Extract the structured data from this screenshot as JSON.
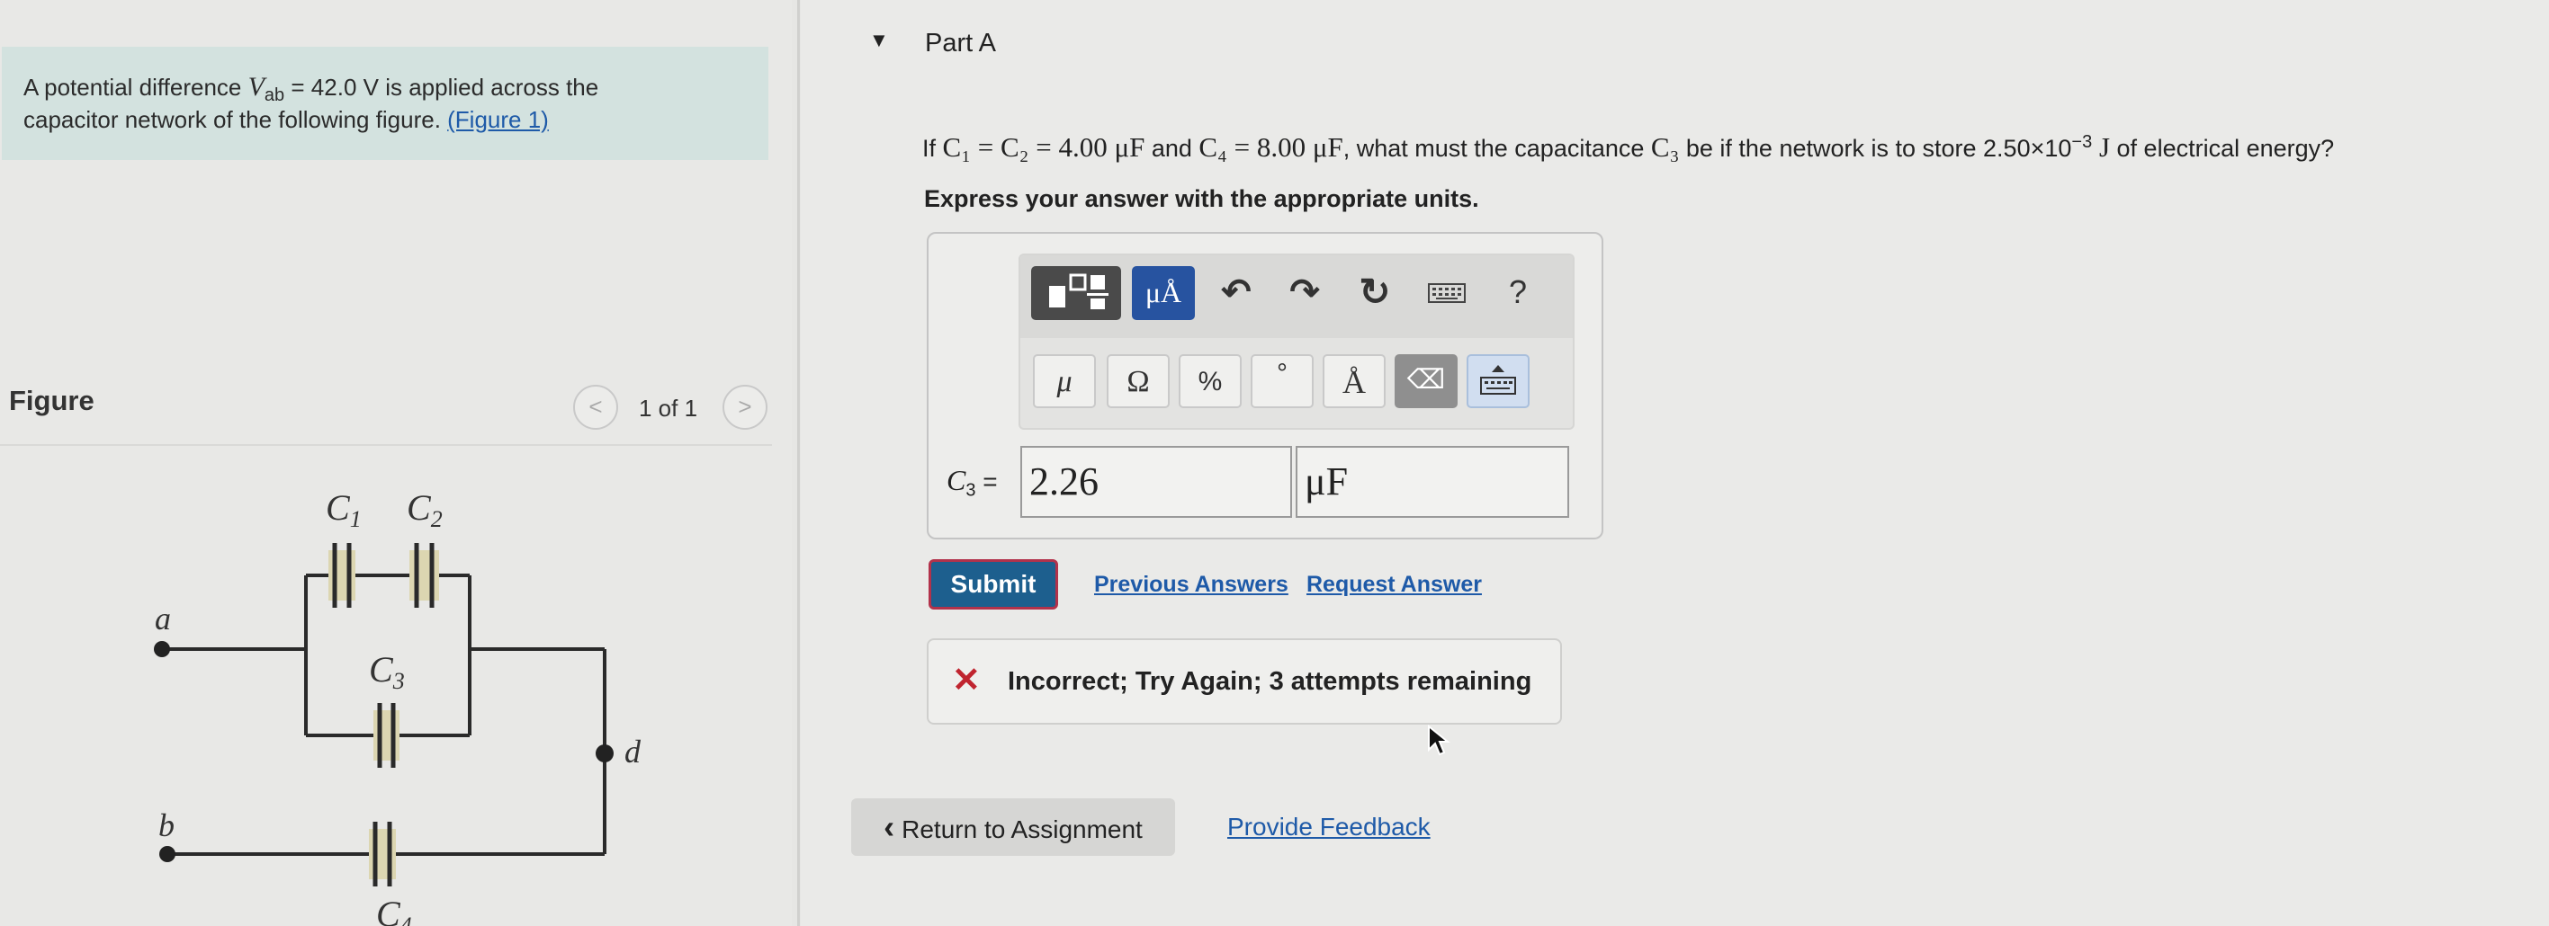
{
  "problem": {
    "text1_pre": "A potential difference ",
    "var": "V",
    "var_sub": "ab",
    "text1_post": " = 42.0 V is applied across the",
    "text2": "capacitor network of the following figure. ",
    "figure_link": "(Figure 1)"
  },
  "figure": {
    "label": "Figure",
    "pager_prev": "<",
    "pager_next": ">",
    "pager_count": "1 of 1",
    "labels": {
      "c1": "C",
      "c1_sub": "1",
      "c2": "C",
      "c2_sub": "2",
      "c3": "C",
      "c3_sub": "3",
      "c4": "C",
      "c4_sub": "4",
      "a": "a",
      "b": "b",
      "d": "d"
    },
    "wire_color": "#2a2a2a",
    "capacitor_color": "#2a2a2a"
  },
  "part": {
    "label": "Part A",
    "toggle": "▼"
  },
  "question": {
    "p1": "If ",
    "p2": "C₁ = C₂ = 4.00 μF",
    "p3": " and ",
    "p4": "C₄ = 8.00 μF",
    "p5": ", what must the capacitance ",
    "p6": "C₃",
    "p7": " be if the network is to store 2.50×10",
    "p7_sup": "−3",
    "p8": " J",
    "p9": " of electrical energy?"
  },
  "instruction": "Express your answer with the appropriate units.",
  "toolbar": {
    "templates_icon": "templates-icon",
    "units_label": "μÅ",
    "undo_icon": "↶",
    "redo_icon": "↷",
    "reset_icon": "↻",
    "keyboard_icon": "keyboard-icon",
    "help_label": "?",
    "mu_label": "μ",
    "omega_label": "Ω",
    "percent_label": "%",
    "degree_label": "°",
    "angstrom_label": "Å",
    "backspace_icon": "⌫",
    "active_color": "#2753a0"
  },
  "answer": {
    "label_var": "C",
    "label_sub": "3",
    "label_eq": " =",
    "value": "2.26",
    "unit": "μF"
  },
  "actions": {
    "submit": "Submit",
    "previous_answers": "Previous Answers",
    "request_answer": "Request Answer"
  },
  "feedback": {
    "icon": "✕",
    "text": "Incorrect; Try Again; 3 attempts remaining"
  },
  "footer": {
    "return_label": "Return to Assignment",
    "return_icon": "‹",
    "provide_feedback": "Provide Feedback"
  }
}
